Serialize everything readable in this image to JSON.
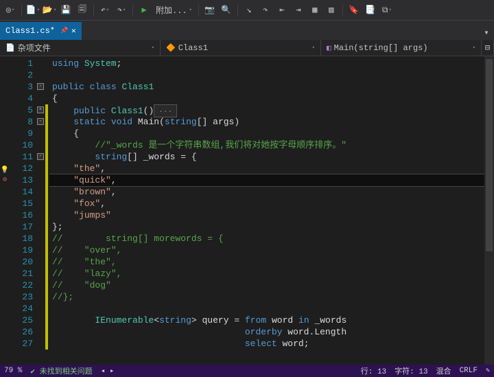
{
  "toolbar": {
    "attach_label": "附加..."
  },
  "tab": {
    "filename": "Class1.cs*"
  },
  "breadcrumb": {
    "misc_files": "杂项文件",
    "class_name": "Class1",
    "method_sig": "Main(string[] args)"
  },
  "code": {
    "lines": [
      {
        "n": 1,
        "html": "<span class='kw'>using</span> <span class='type'>System</span><span class='punct'>;</span>"
      },
      {
        "n": 2,
        "html": ""
      },
      {
        "n": 3,
        "html": "<span class='kw'>public</span> <span class='kw'>class</span> <span class='type'>Class1</span>",
        "fold": "-"
      },
      {
        "n": 4,
        "html": "<span class='punct'>{</span>"
      },
      {
        "n": 5,
        "html": "    <span class='kw'>public</span> <span class='type'>Class1</span><span class='punct'>()</span><span class='param-box'>...</span>",
        "fold": "+"
      },
      {
        "n": 8,
        "html": "    <span class='kw'>static</span> <span class='kw'>void</span> <span class='id'>Main</span><span class='punct'>(</span><span class='kw'>string</span><span class='punct'>[]</span> <span class='id'>args</span><span class='punct'>)</span>",
        "fold": "-"
      },
      {
        "n": 9,
        "html": "    <span class='punct'>{</span>"
      },
      {
        "n": 10,
        "html": "        <span class='cm'>//\"_words 是一个字符串数组,我们将对她按字母顺序排序。\"</span>"
      },
      {
        "n": 11,
        "html": "        <span class='kw'>string</span><span class='punct'>[]</span> <span class='id'>_words</span> <span class='punct'>=</span> <span class='punct'>{</span>",
        "fold": "-"
      },
      {
        "n": 12,
        "html": "    <span class='str'>\"the\"</span><span class='punct'>,</span>"
      },
      {
        "n": 13,
        "html": "    <span class='str'>\"quick\"</span><span class='punct'>,</span>",
        "current": true
      },
      {
        "n": 14,
        "html": "    <span class='str'>\"brown\"</span><span class='punct'>,</span>"
      },
      {
        "n": 15,
        "html": "    <span class='str'>\"fox\"</span><span class='punct'>,</span>"
      },
      {
        "n": 16,
        "html": "    <span class='str'>\"jumps\"</span>"
      },
      {
        "n": 17,
        "html": "<span class='punct'>};</span>"
      },
      {
        "n": 18,
        "html": "<span class='cm'>//        string[] morewords = {</span>"
      },
      {
        "n": 19,
        "html": "<span class='cm'>//    \"over\",</span>"
      },
      {
        "n": 20,
        "html": "<span class='cm'>//    \"the\",</span>"
      },
      {
        "n": 21,
        "html": "<span class='cm'>//    \"lazy\",</span>"
      },
      {
        "n": 22,
        "html": "<span class='cm'>//    \"dog\"</span>"
      },
      {
        "n": 23,
        "html": "<span class='cm'>//};</span>"
      },
      {
        "n": 24,
        "html": ""
      },
      {
        "n": 25,
        "html": "        <span class='type'>IEnumerable</span><span class='punct'>&lt;</span><span class='kw'>string</span><span class='punct'>&gt;</span> <span class='id'>query</span> <span class='punct'>=</span> <span class='kw'>from</span> <span class='id'>word</span> <span class='kw'>in</span> <span class='id'>_words</span>"
      },
      {
        "n": 26,
        "html": "                                    <span class='kw'>orderby</span> <span class='id'>word</span><span class='punct'>.</span><span class='id'>Length</span>"
      },
      {
        "n": 27,
        "html": "                                    <span class='kw'>select</span> <span class='id'>word</span><span class='punct'>;</span>"
      }
    ],
    "mod_from": 5,
    "mod_to": 27
  },
  "status": {
    "zoom": "79 %",
    "no_issues": "未找到相关问题",
    "line_label": "行: 13",
    "char_label": "字符: 13",
    "tabs_label": "混合",
    "line_ending": "CRLF"
  }
}
